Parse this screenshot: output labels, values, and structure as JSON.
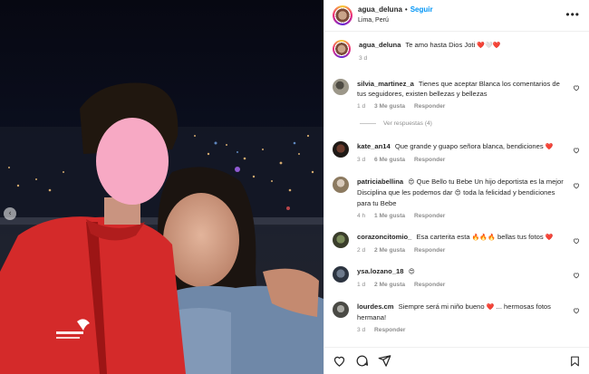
{
  "header": {
    "username": "agua_deluna",
    "follow_label": "Seguir",
    "location": "Lima, Perú",
    "more_icon": "ellipsis-icon"
  },
  "caption": {
    "username": "agua_deluna",
    "text": "Te amo hasta Dios Joti",
    "emojis": "❤️🤍❤️",
    "time": "3 d"
  },
  "comments": [
    {
      "username": "silvia_martinez_a",
      "text": "Tienes que aceptar Blanca los comentarios de tus seguidores, existen bellezas y bellezas",
      "time": "1 d",
      "likes": "3 Me gusta",
      "reply": "Responder"
    },
    {
      "username": "kate_an14",
      "text": "Que grande y guapo señora blanca, bendiciones",
      "emoji": "❤️",
      "time": "3 d",
      "likes": "6 Me gusta",
      "reply": "Responder"
    },
    {
      "username": "patriciabellina",
      "emoji_pre": "😍",
      "text": "Que Bello tu Bebe Un hijo deportista es la mejor Disciplina que les podemos dar",
      "emoji_mid": "😍",
      "text2": "toda la felicidad y bendiciones para tu Bebe",
      "time": "4 h",
      "likes": "1 Me gusta",
      "reply": "Responder"
    },
    {
      "username": "corazoncitomio_",
      "text": "Esa carterita esta",
      "emoji": "🔥🔥🔥",
      "text2": "bellas tus fotos",
      "emoji2": "❤️",
      "time": "2 d",
      "likes": "2 Me gusta",
      "reply": "Responder"
    },
    {
      "username": "ysa.lozano_18",
      "emoji": "😍",
      "time": "1 d",
      "likes": "2 Me gusta",
      "reply": "Responder"
    },
    {
      "username": "lourdes.cm",
      "text": "Siempre será mi niño bueno",
      "emoji": "❤️",
      "text2": "... hermosas fotos hermana!",
      "time": "3 d",
      "likes": "",
      "reply": "Responder"
    }
  ],
  "view_replies": "Ver respuestas (4)",
  "actions": {
    "like_icon": "heart-icon",
    "comment_icon": "comment-icon",
    "share_icon": "send-icon",
    "save_icon": "bookmark-icon"
  },
  "photo": {
    "carousel_prev_icon": "chevron-left-icon",
    "jacket_logo": "logo"
  }
}
